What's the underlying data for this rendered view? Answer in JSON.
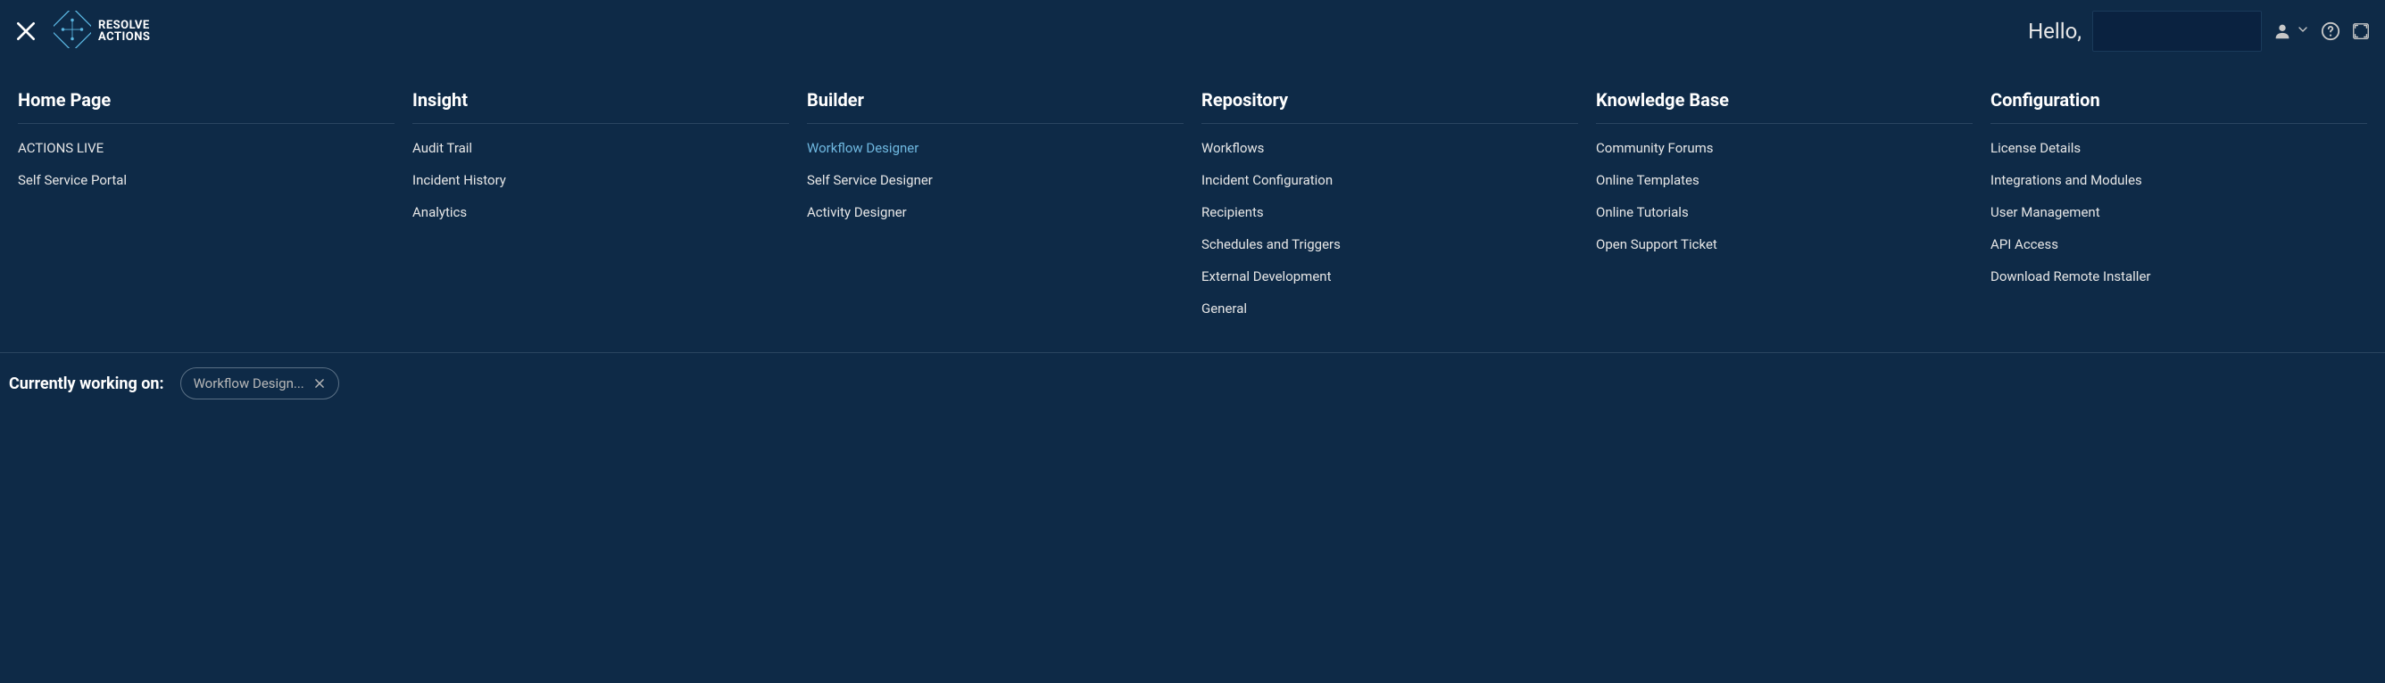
{
  "header": {
    "logo_top": "RESOLVE",
    "logo_bottom": "ACTIONS",
    "greeting": "Hello,"
  },
  "nav": {
    "columns": [
      {
        "heading": "Home Page",
        "items": [
          {
            "label": "ACTIONS LIVE",
            "active": false
          },
          {
            "label": "Self Service Portal",
            "active": false
          }
        ]
      },
      {
        "heading": "Insight",
        "items": [
          {
            "label": "Audit Trail",
            "active": false
          },
          {
            "label": "Incident History",
            "active": false
          },
          {
            "label": "Analytics",
            "active": false
          }
        ]
      },
      {
        "heading": "Builder",
        "items": [
          {
            "label": "Workflow Designer",
            "active": true
          },
          {
            "label": "Self Service Designer",
            "active": false
          },
          {
            "label": "Activity Designer",
            "active": false
          }
        ]
      },
      {
        "heading": "Repository",
        "items": [
          {
            "label": "Workflows",
            "active": false
          },
          {
            "label": "Incident Configuration",
            "active": false
          },
          {
            "label": "Recipients",
            "active": false
          },
          {
            "label": "Schedules and Triggers",
            "active": false
          },
          {
            "label": "External Development",
            "active": false
          },
          {
            "label": "General",
            "active": false
          }
        ]
      },
      {
        "heading": "Knowledge Base",
        "items": [
          {
            "label": "Community Forums",
            "active": false
          },
          {
            "label": "Online Templates",
            "active": false
          },
          {
            "label": "Online Tutorials",
            "active": false
          },
          {
            "label": "Open Support Ticket",
            "active": false
          }
        ]
      },
      {
        "heading": "Configuration",
        "items": [
          {
            "label": "License Details",
            "active": false
          },
          {
            "label": "Integrations and Modules",
            "active": false
          },
          {
            "label": "User Management",
            "active": false
          },
          {
            "label": "API Access",
            "active": false
          },
          {
            "label": "Download Remote Installer",
            "active": false
          }
        ]
      }
    ]
  },
  "footer": {
    "label": "Currently working on:",
    "chips": [
      {
        "label": "Workflow Design..."
      }
    ]
  }
}
